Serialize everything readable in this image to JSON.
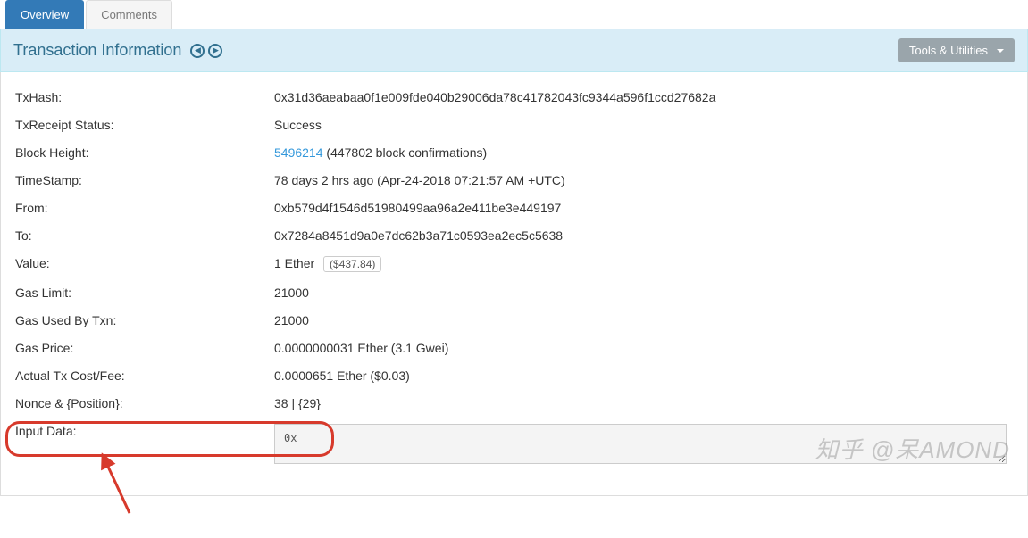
{
  "tabs": {
    "overview": "Overview",
    "comments": "Comments"
  },
  "panel": {
    "title": "Transaction Information",
    "tools_btn": "Tools & Utilities"
  },
  "fields": {
    "txhash_label": "TxHash:",
    "txhash_value": "0x31d36aeabaa0f1e009fde040b29006da78c41782043fc9344a596f1ccd27682a",
    "txreceipt_label": "TxReceipt Status:",
    "txreceipt_value": "Success",
    "blockheight_label": "Block Height:",
    "blockheight_link": "5496214",
    "blockheight_conf": " (447802 block confirmations)",
    "timestamp_label": "TimeStamp:",
    "timestamp_value": "78 days 2 hrs ago (Apr-24-2018 07:21:57 AM +UTC)",
    "from_label": "From:",
    "from_value": "0xb579d4f1546d51980499aa96a2e411be3e449197",
    "to_label": "To:",
    "to_value": "0x7284a8451d9a0e7dc62b3a71c0593ea2ec5c5638",
    "value_label": "Value:",
    "value_eth": "1 Ether",
    "value_usd": "($437.84)",
    "gaslimit_label": "Gas Limit:",
    "gaslimit_value": "21000",
    "gasused_label": "Gas Used By Txn:",
    "gasused_value": "21000",
    "gasprice_label": "Gas Price:",
    "gasprice_value": "0.0000000031 Ether (3.1 Gwei)",
    "txfee_label": "Actual Tx Cost/Fee:",
    "txfee_value": "0.0000651 Ether ($0.03)",
    "nonce_label": "Nonce & {Position}:",
    "nonce_value": "38 | {29}",
    "inputdata_label": "Input Data:",
    "inputdata_value": "0x"
  },
  "watermark": "知乎 @呆AMOND"
}
